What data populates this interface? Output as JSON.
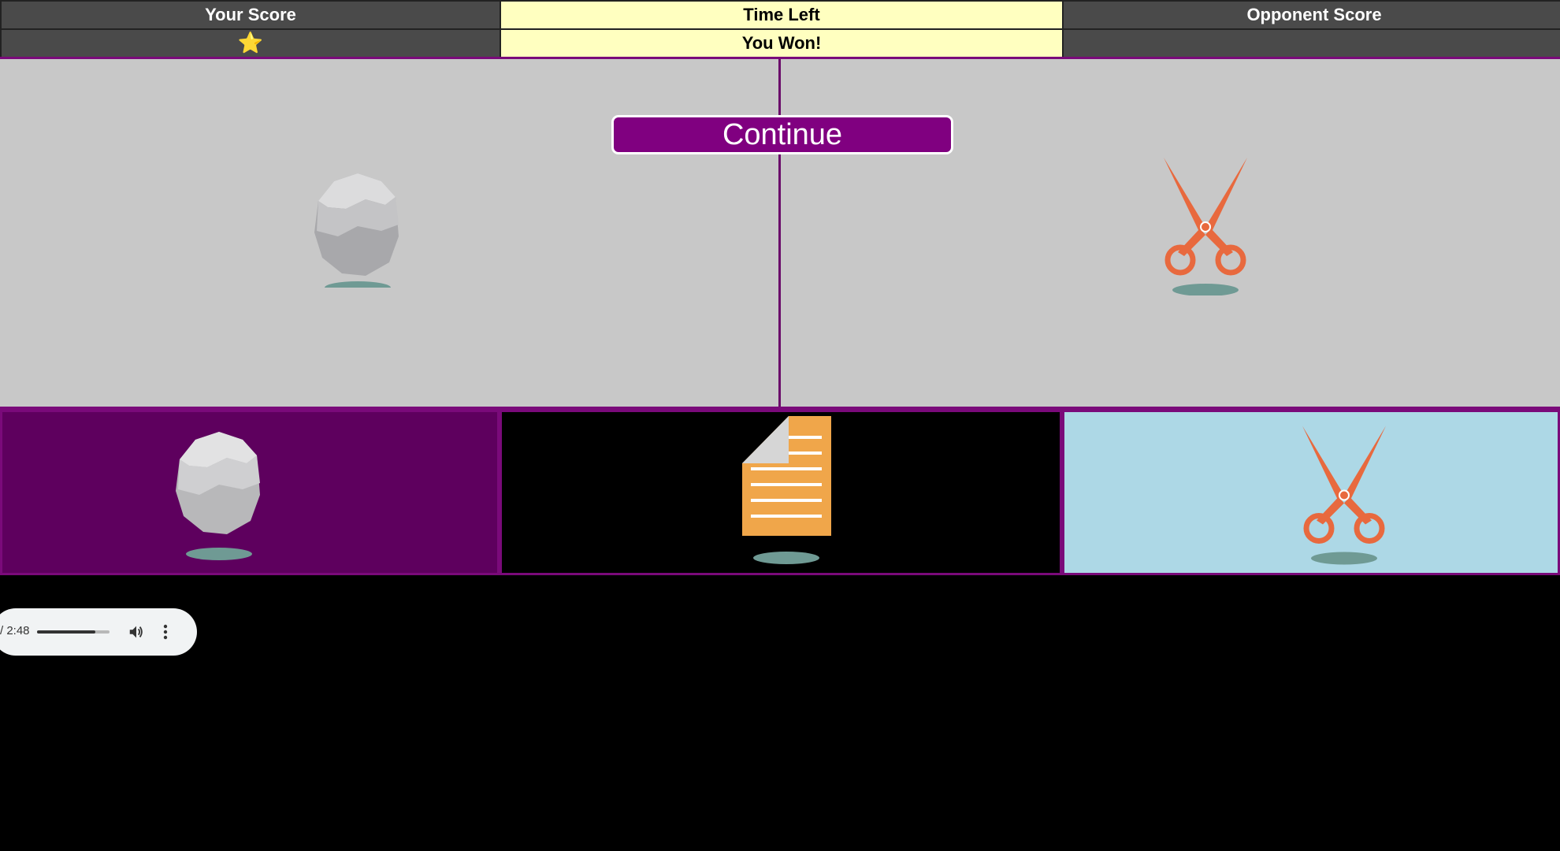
{
  "scoreboard": {
    "headers": {
      "your_score": "Your Score",
      "time_left": "Time Left",
      "opponent_score": "Opponent Score"
    },
    "values": {
      "your_score": "⭐",
      "time_left": "You Won!",
      "opponent_score": ""
    }
  },
  "arena": {
    "continue_label": "Continue",
    "player_choice": "rock",
    "opponent_choice": "scissors"
  },
  "choices": [
    {
      "id": "rock",
      "icon": "rock-icon",
      "background": "#5e005e",
      "state": "selected"
    },
    {
      "id": "paper",
      "icon": "paper-icon",
      "background": "#000000",
      "state": "default"
    },
    {
      "id": "scissors",
      "icon": "scissors-icon",
      "background": "#add8e6",
      "state": "opponent"
    }
  ],
  "colors": {
    "accent": "#800080",
    "scoreboard_dark": "#4a4a4a",
    "scoreboard_light": "#ffffc0",
    "arena_bg": "#c8c8c8",
    "scissors": "#e8693e",
    "paper": "#f0a64a",
    "rock": "#c8c8ca"
  },
  "audio": {
    "time_display": "/ 2:48",
    "progress": 0.8
  }
}
